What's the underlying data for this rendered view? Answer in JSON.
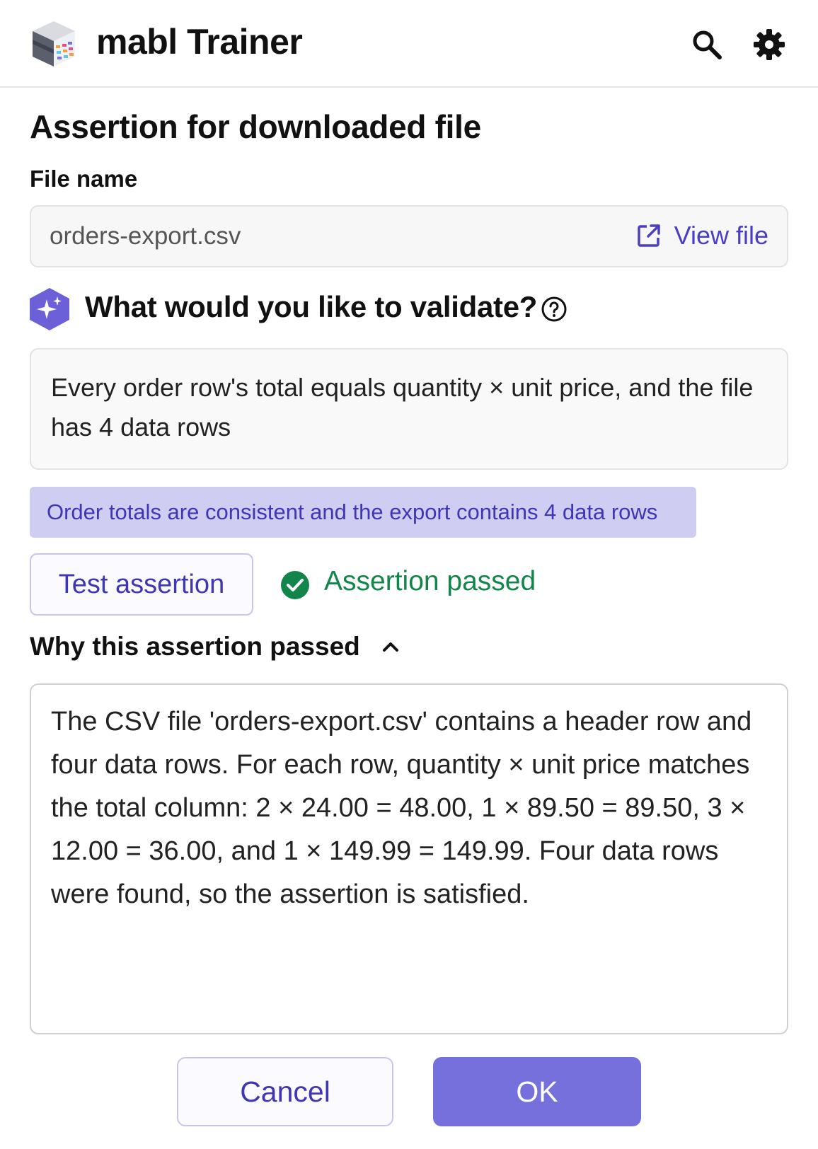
{
  "header": {
    "app_title": "mabl Trainer",
    "logo_icon": "mabl-cube-logo-icon",
    "search_icon": "search-icon",
    "settings_icon": "gear-icon"
  },
  "dialog": {
    "title": "Assertion for downloaded file",
    "file_label": "File name",
    "file_name": "orders-export.csv",
    "view_file_label": "View file",
    "question": "What would you like to validate?",
    "prompt": "Every order row's total equals quantity × unit price, and the file has 4 data rows",
    "summary": "Order totals are consistent and the export contains 4 data rows",
    "test_button": "Test assertion",
    "result": "Assertion passed",
    "why_label": "Why this assertion passed",
    "explanation": "The CSV file 'orders-export.csv' contains a header row and four data rows. For each row, quantity × unit price matches the total column: 2 × 24.00 = 48.00, 1 × 89.50 = 89.50, 3 × 12.00 = 36.00, and 1 × 149.99 = 149.99. Four data rows were found, so the assertion is satisfied.",
    "cancel_button": "Cancel",
    "ok_button": "OK"
  },
  "colors": {
    "accent": "#4a3fc2",
    "primary_button": "#7670dc",
    "summary_bg": "#cfcdf2",
    "success": "#12864a"
  }
}
